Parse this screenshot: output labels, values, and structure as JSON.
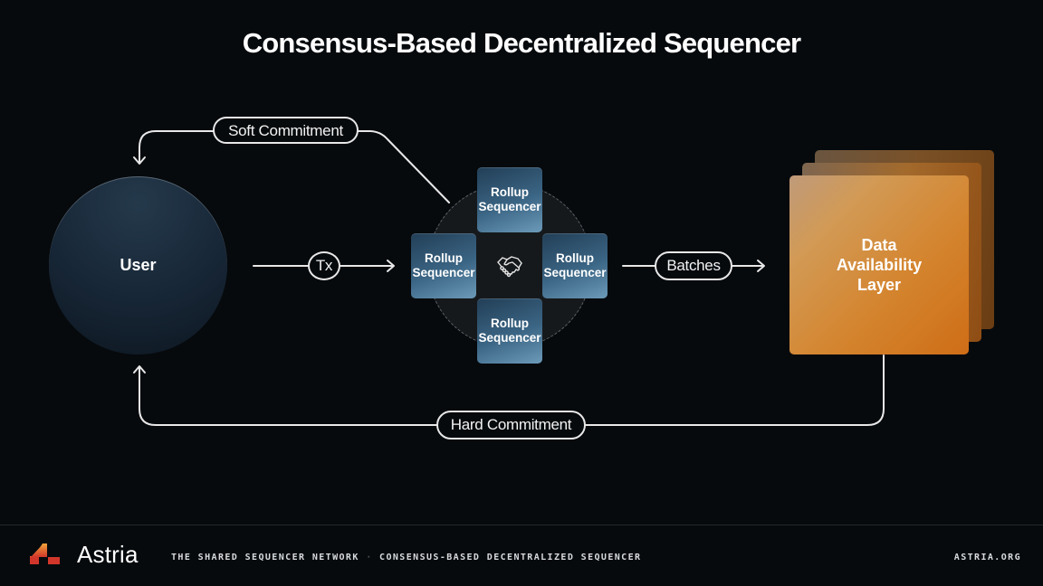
{
  "title": "Consensus-Based Decentralized Sequencer",
  "nodes": {
    "user": "User",
    "sequencers": [
      {
        "line1": "Rollup",
        "line2": "Sequencer",
        "position": "top"
      },
      {
        "line1": "Rollup",
        "line2": "Sequencer",
        "position": "left"
      },
      {
        "line1": "Rollup",
        "line2": "Sequencer",
        "position": "right"
      },
      {
        "line1": "Rollup",
        "line2": "Sequencer",
        "position": "bottom"
      }
    ],
    "consensus_icon": "handshake-icon",
    "data_availability": {
      "line1": "Data",
      "line2": "Availability",
      "line3": "Layer"
    }
  },
  "edges": {
    "soft_commitment": "Soft Commitment",
    "tx": "Tx",
    "batches": "Batches",
    "hard_commitment": "Hard Commitment"
  },
  "footer": {
    "brand": "Astria",
    "tagline": "THE SHARED SEQUENCER NETWORK",
    "separator": "·",
    "subtitle": "CONSENSUS-BASED DECENTRALIZED SEQUENCER",
    "url": "ASTRIA.ORG"
  },
  "colors": {
    "background": "#060a0d",
    "sequencer": "#3b6584",
    "data_availability": "#d4852f",
    "user": "#172636"
  }
}
